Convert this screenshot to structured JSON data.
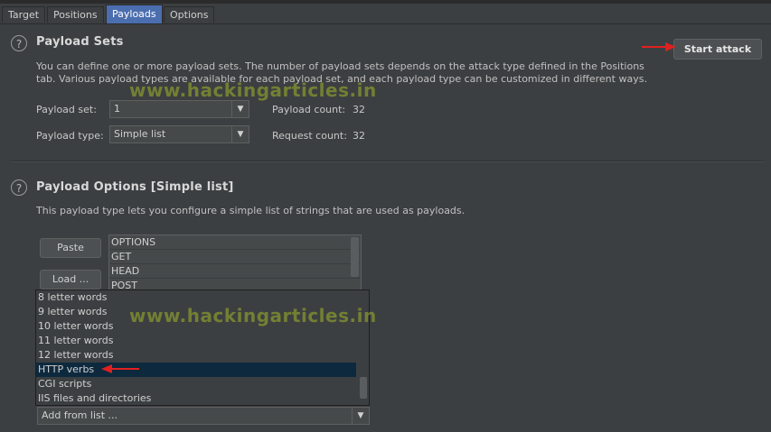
{
  "tabs": [
    {
      "label": "Target"
    },
    {
      "label": "Positions"
    },
    {
      "label": "Payloads"
    },
    {
      "label": "Options"
    }
  ],
  "payload_sets": {
    "title": "Payload Sets",
    "description_line1": "You can define one or more payload sets. The number of payload sets depends on the attack type defined in the Positions",
    "description_line2": "tab. Various payload types are available for each payload set, and each payload type can be customized in different ways.",
    "start_attack_label": "Start attack",
    "payload_set_label": "Payload set:",
    "payload_set_value": "1",
    "payload_type_label": "Payload type:",
    "payload_type_value": "Simple list",
    "payload_count_label": "Payload count:",
    "payload_count_value": "32",
    "request_count_label": "Request count:",
    "request_count_value": "32"
  },
  "payload_options": {
    "title": "Payload Options [Simple list]",
    "description": "This payload type lets you configure a simple list of strings that are used as payloads.",
    "paste_label": "Paste",
    "load_label": "Load ...",
    "list_items": [
      "OPTIONS",
      "GET",
      "HEAD",
      "POST"
    ],
    "dropdown_items": [
      "8 letter words",
      "9 letter words",
      "10 letter words",
      "11 letter words",
      "12 letter words",
      "HTTP verbs",
      "CGI scripts",
      "IIS files and directories"
    ],
    "selected_item": "HTTP verbs",
    "add_from_list_label": "Add from list ..."
  },
  "watermark": "www.hackingarticles.in",
  "colors": {
    "background": "#3c3f41",
    "tab_active": "#4b6eaf",
    "selection": "#0d293e",
    "annotation_arrow": "#e02020"
  }
}
